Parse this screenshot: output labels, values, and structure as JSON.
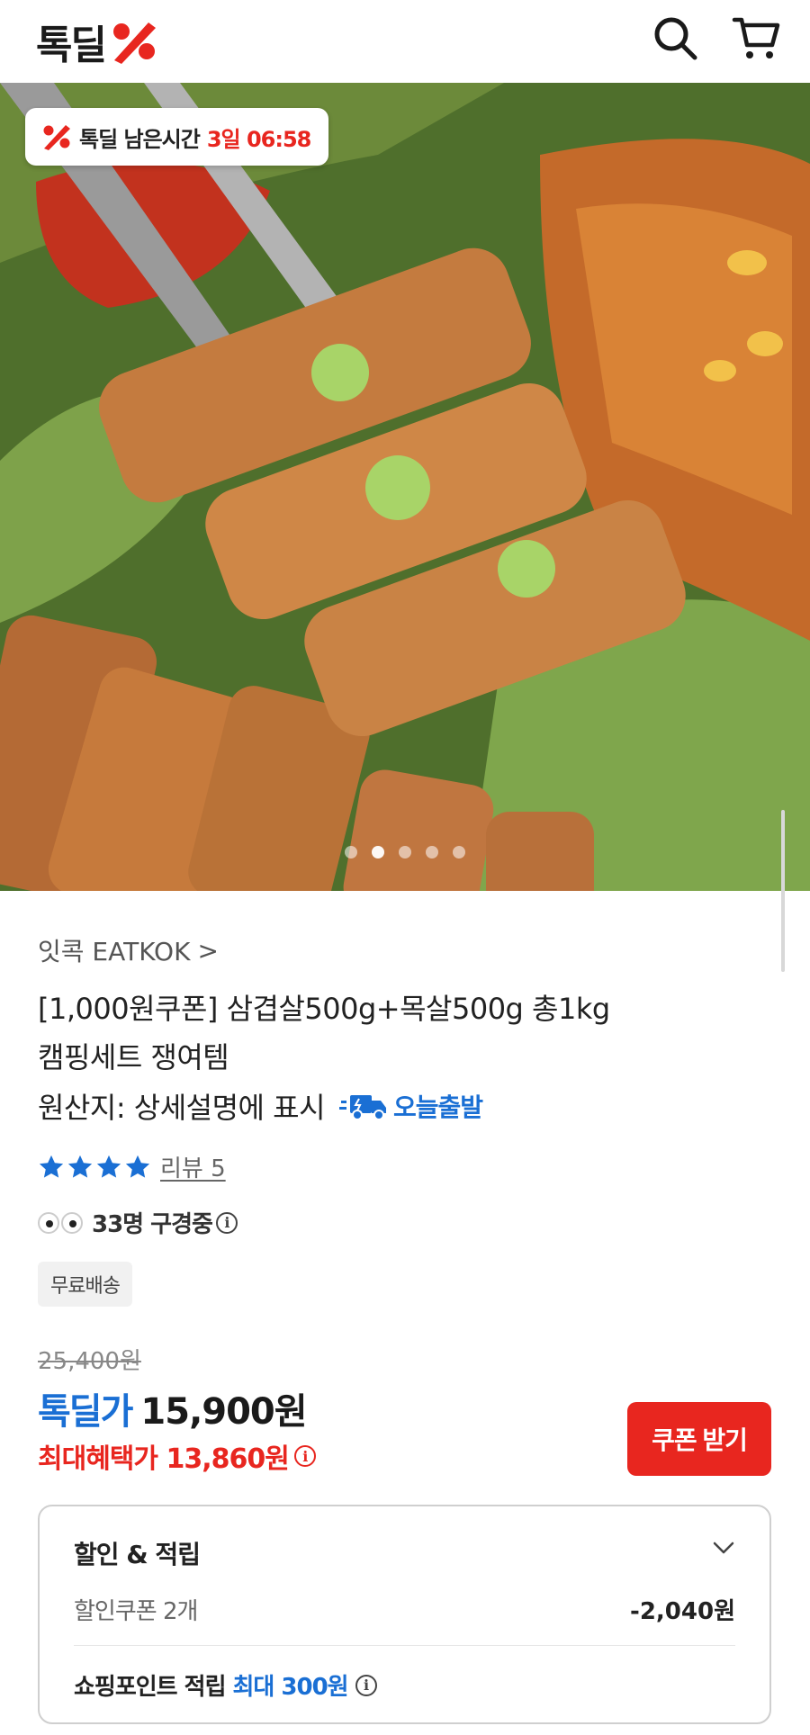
{
  "header": {
    "logo_text": "톡딜",
    "logo_icon": "percent-mark-icon",
    "search_icon": "search-icon",
    "cart_icon": "cart-icon"
  },
  "hero": {
    "timer_label": "톡딜 남은시간",
    "timer_value": "3일 06:58",
    "dot_count": 5
  },
  "product": {
    "seller": "잇콕 EATKOK",
    "seller_chevron": ">",
    "title_line1": "[1,000원쿠폰] 삼겹살500g+목살500g 총1kg",
    "title_line2": "캠핑세트 쟁여템",
    "origin": "원산지: 상세설명에 표시",
    "ship_today": "오늘출발",
    "rating_stars": 4,
    "review": "리뷰 5",
    "viewers": "33명 구경중",
    "free_shipping": "무료배송"
  },
  "pricing": {
    "original": "25,400원",
    "deal_label": "톡딜가",
    "deal_price": "15,900원",
    "max_benefit": "최대혜택가 13,860원",
    "coupon_button": "쿠폰 받기"
  },
  "benefits": {
    "title": "할인 & 적립",
    "coupon_label": "할인쿠폰 2개",
    "coupon_value": "-2,040원",
    "points_label": "쇼핑포인트 적립",
    "points_value": "최대 300원"
  },
  "colors": {
    "brand_red": "#e8261f",
    "brand_blue": "#1a6fd4"
  }
}
